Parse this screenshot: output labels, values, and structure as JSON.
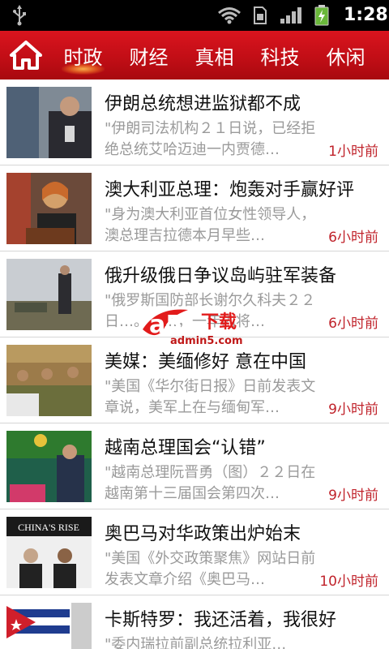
{
  "status_bar": {
    "time": "1:28",
    "icons": [
      "usb-icon",
      "wifi-icon",
      "sim-icon",
      "signal-icon",
      "battery-charging-icon"
    ]
  },
  "nav": {
    "home_icon": "home-icon",
    "tabs": [
      {
        "label": "时政",
        "active": true
      },
      {
        "label": "财经",
        "active": false
      },
      {
        "label": "真相",
        "active": false
      },
      {
        "label": "科技",
        "active": false
      },
      {
        "label": "休闲",
        "active": false
      }
    ]
  },
  "news": [
    {
      "title": "伊朗总统想进监狱都不成",
      "summary": "\"伊朗司法机构２１日说，已经拒绝总统艾哈迈迪一内贾德…",
      "time": "1小时前"
    },
    {
      "title": "澳大利亚总理：炮轰对手赢好评",
      "summary": "\"身为澳大利亚首位女性领导人，澳总理吉拉德本月早些…",
      "time": "6小时前"
    },
    {
      "title": "俄升级俄日争议岛屿驻军装备",
      "summary": "\"俄罗斯国防部长谢尔久科夫２２日…。……，一年内将…",
      "time": "6小时前"
    },
    {
      "title": "美媒：美缅修好 意在中国",
      "summary": "\"美国《华尔街日报》日前发表文章说，美军上在与缅甸军…",
      "time": "9小时前"
    },
    {
      "title": "越南总理国会“认错”",
      "summary": "\"越南总理阮晋勇（图）２２日在越南第十三届国会第四次…",
      "time": "9小时前"
    },
    {
      "title": "奥巴马对华政策出炉始末",
      "summary": "\"美国《外交政策聚焦》网站日前发表文章介绍《奥巴马…",
      "time": "10小时前"
    },
    {
      "title": "卡斯特罗：我还活着，我很好",
      "summary": "\"委内瑞拉前副总统拉利亚…",
      "time": ""
    }
  ],
  "thumbnail_texts": {
    "thumb6": "CHINA'S RISE"
  },
  "watermark": {
    "brand": "a5",
    "label": "下载",
    "site": "admin5.com"
  },
  "colors": {
    "nav_red": "#c8101a",
    "time_red": "#c0232b",
    "summary_gray": "#9a9a9a"
  }
}
